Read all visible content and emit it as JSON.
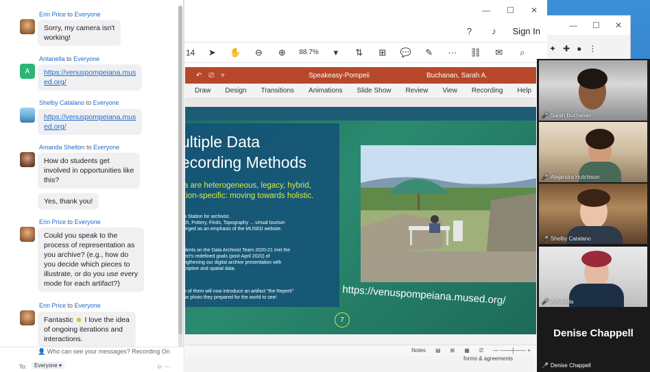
{
  "chat": {
    "messages": [
      {
        "sender": "Erin Price",
        "to_label": "to",
        "recipient": "Everyone",
        "lines": [
          "Sorry, my camera isn't",
          "working!"
        ]
      },
      {
        "sender": "Antanella",
        "to_label": "to",
        "recipient": "Everyone",
        "avatar_letter": "A",
        "link_lines": [
          "https://venuspompeiana.mus",
          "ed.org/"
        ]
      },
      {
        "sender": "Shelby Catalano",
        "to_label": "to",
        "recipient": "Everyone",
        "link_lines": [
          "https://venuspompeiana.mus",
          "ed.org/"
        ]
      },
      {
        "sender": "Amanda Shelton",
        "to_label": "to",
        "recipient": "Everyone",
        "lines": [
          "How do students get",
          "involved in opportunities like",
          "this?"
        ],
        "followup": "Yes, thank you!"
      },
      {
        "sender": "Erin Price",
        "to_label": "to",
        "recipient": "Everyone",
        "lines": [
          "Could you speak to the",
          "process of representation as",
          "you archive? (e.g., how do",
          "you decide which pieces to",
          "illustrate, or do you use every",
          "mode for each artifact?)"
        ]
      },
      {
        "sender": "Erin Price",
        "to_label": "to",
        "recipient": "Everyone",
        "lines": [
          "Fantastic",
          " I love the idea",
          "of ongoing iterations and",
          "interactions."
        ]
      }
    ],
    "privacy_note": "Who can see your messages? Recording On",
    "to_label": "To:",
    "to_value": "Everyone"
  },
  "reader": {
    "sign_in": "Sign In",
    "zoom_level": "88.7%",
    "page_hint": "14"
  },
  "ppt": {
    "doc_name": "Speakeasy-Pompeii",
    "user_name": "Buchanan, Sarah A.",
    "tabs": [
      "Draw",
      "Design",
      "Transitions",
      "Animations",
      "Slide Show",
      "Review",
      "View",
      "Recording",
      "Help"
    ],
    "status_notes": "Notes",
    "below_text": "forms & agreements"
  },
  "slide": {
    "title_line1": "ultiple Data",
    "title_line2": "ecording Methods",
    "subtitle_line1": "a are heterogeneous, legacy, hybrid,",
    "subtitle_line2": "tion-specific: moving towards holistic.",
    "bullets": [
      "a Station for archivist.",
      "ch, Pottery, Finds, Topography ... virtual tourism",
      "erged as an emphasis of the MUSED website.",
      "dents on the Data Archivist Team 2020-21 met the",
      "ect's redefined goals (post-April 2020) of",
      "ngthening our digital archive presentation with",
      "criptive and spatial data.",
      "h of them will now introduce an artifact \"the Reperti\"",
      "se photo they prepared for the world to see!"
    ],
    "url": "https://venuspompeiana.mused.org/",
    "page_number": "7"
  },
  "gallery": {
    "participants": [
      "Sarah Buchanan",
      "Alejandra Hutchison",
      "Shelby Catalano",
      "Antanella"
    ],
    "speaker_big": "Denise Chappell",
    "speaker_small": "Denise Chappell"
  }
}
